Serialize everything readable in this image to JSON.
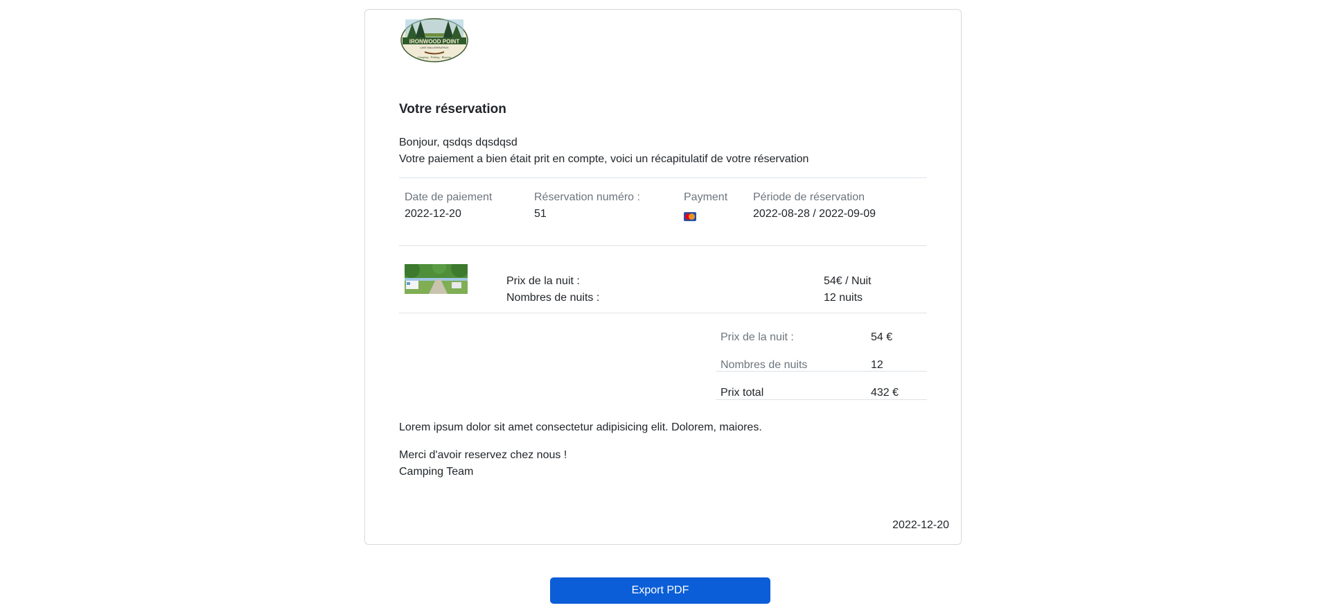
{
  "logo": {
    "brand_text": "IRONWOOD POINT",
    "subtitle_text": "LAKE WALLENPAUPACK",
    "tagline_text": "Camping · Fishing · Boating"
  },
  "reservation": {
    "title": "Votre réservation",
    "greeting": "Bonjour, qsdqs dqsdqsd",
    "message": "Votre paiement a bien était prit en compte, voici un récapitulatif de votre réservation"
  },
  "info": {
    "payment_date_label": "Date de paiement",
    "payment_date_value": "2022-12-20",
    "reservation_number_label": "Réservation numéro :",
    "reservation_number_value": "51",
    "payment_label": "Payment",
    "payment_icon": "mastercard-icon",
    "period_label": "Période de réservation",
    "period_value": "2022-08-28 / 2022-09-09"
  },
  "item": {
    "thumbnail": "campsite-photo",
    "price_label": "Prix de la nuit :",
    "price_value": "54€ / Nuit",
    "nights_label": "Nombres de nuits :",
    "nights_value": "12 nuits"
  },
  "summary": {
    "price_label": "Prix de la nuit :",
    "price_value": "54 €",
    "nights_label": "Nombres de nuits",
    "nights_value": "12",
    "total_label": "Prix total",
    "total_value": "432 €"
  },
  "footer": {
    "lorem": "Lorem ipsum dolor sit amet consectetur adipisicing elit. Dolorem, maiores.",
    "thanks": "Merci d'avoir reservez chez nous !",
    "signature": "Camping Team",
    "date": "2022-12-20"
  },
  "actions": {
    "export_label": "Export PDF"
  },
  "colors": {
    "primary_button": "#0b5ed7",
    "muted_text": "#6c757d",
    "divider": "#dee2e6"
  }
}
